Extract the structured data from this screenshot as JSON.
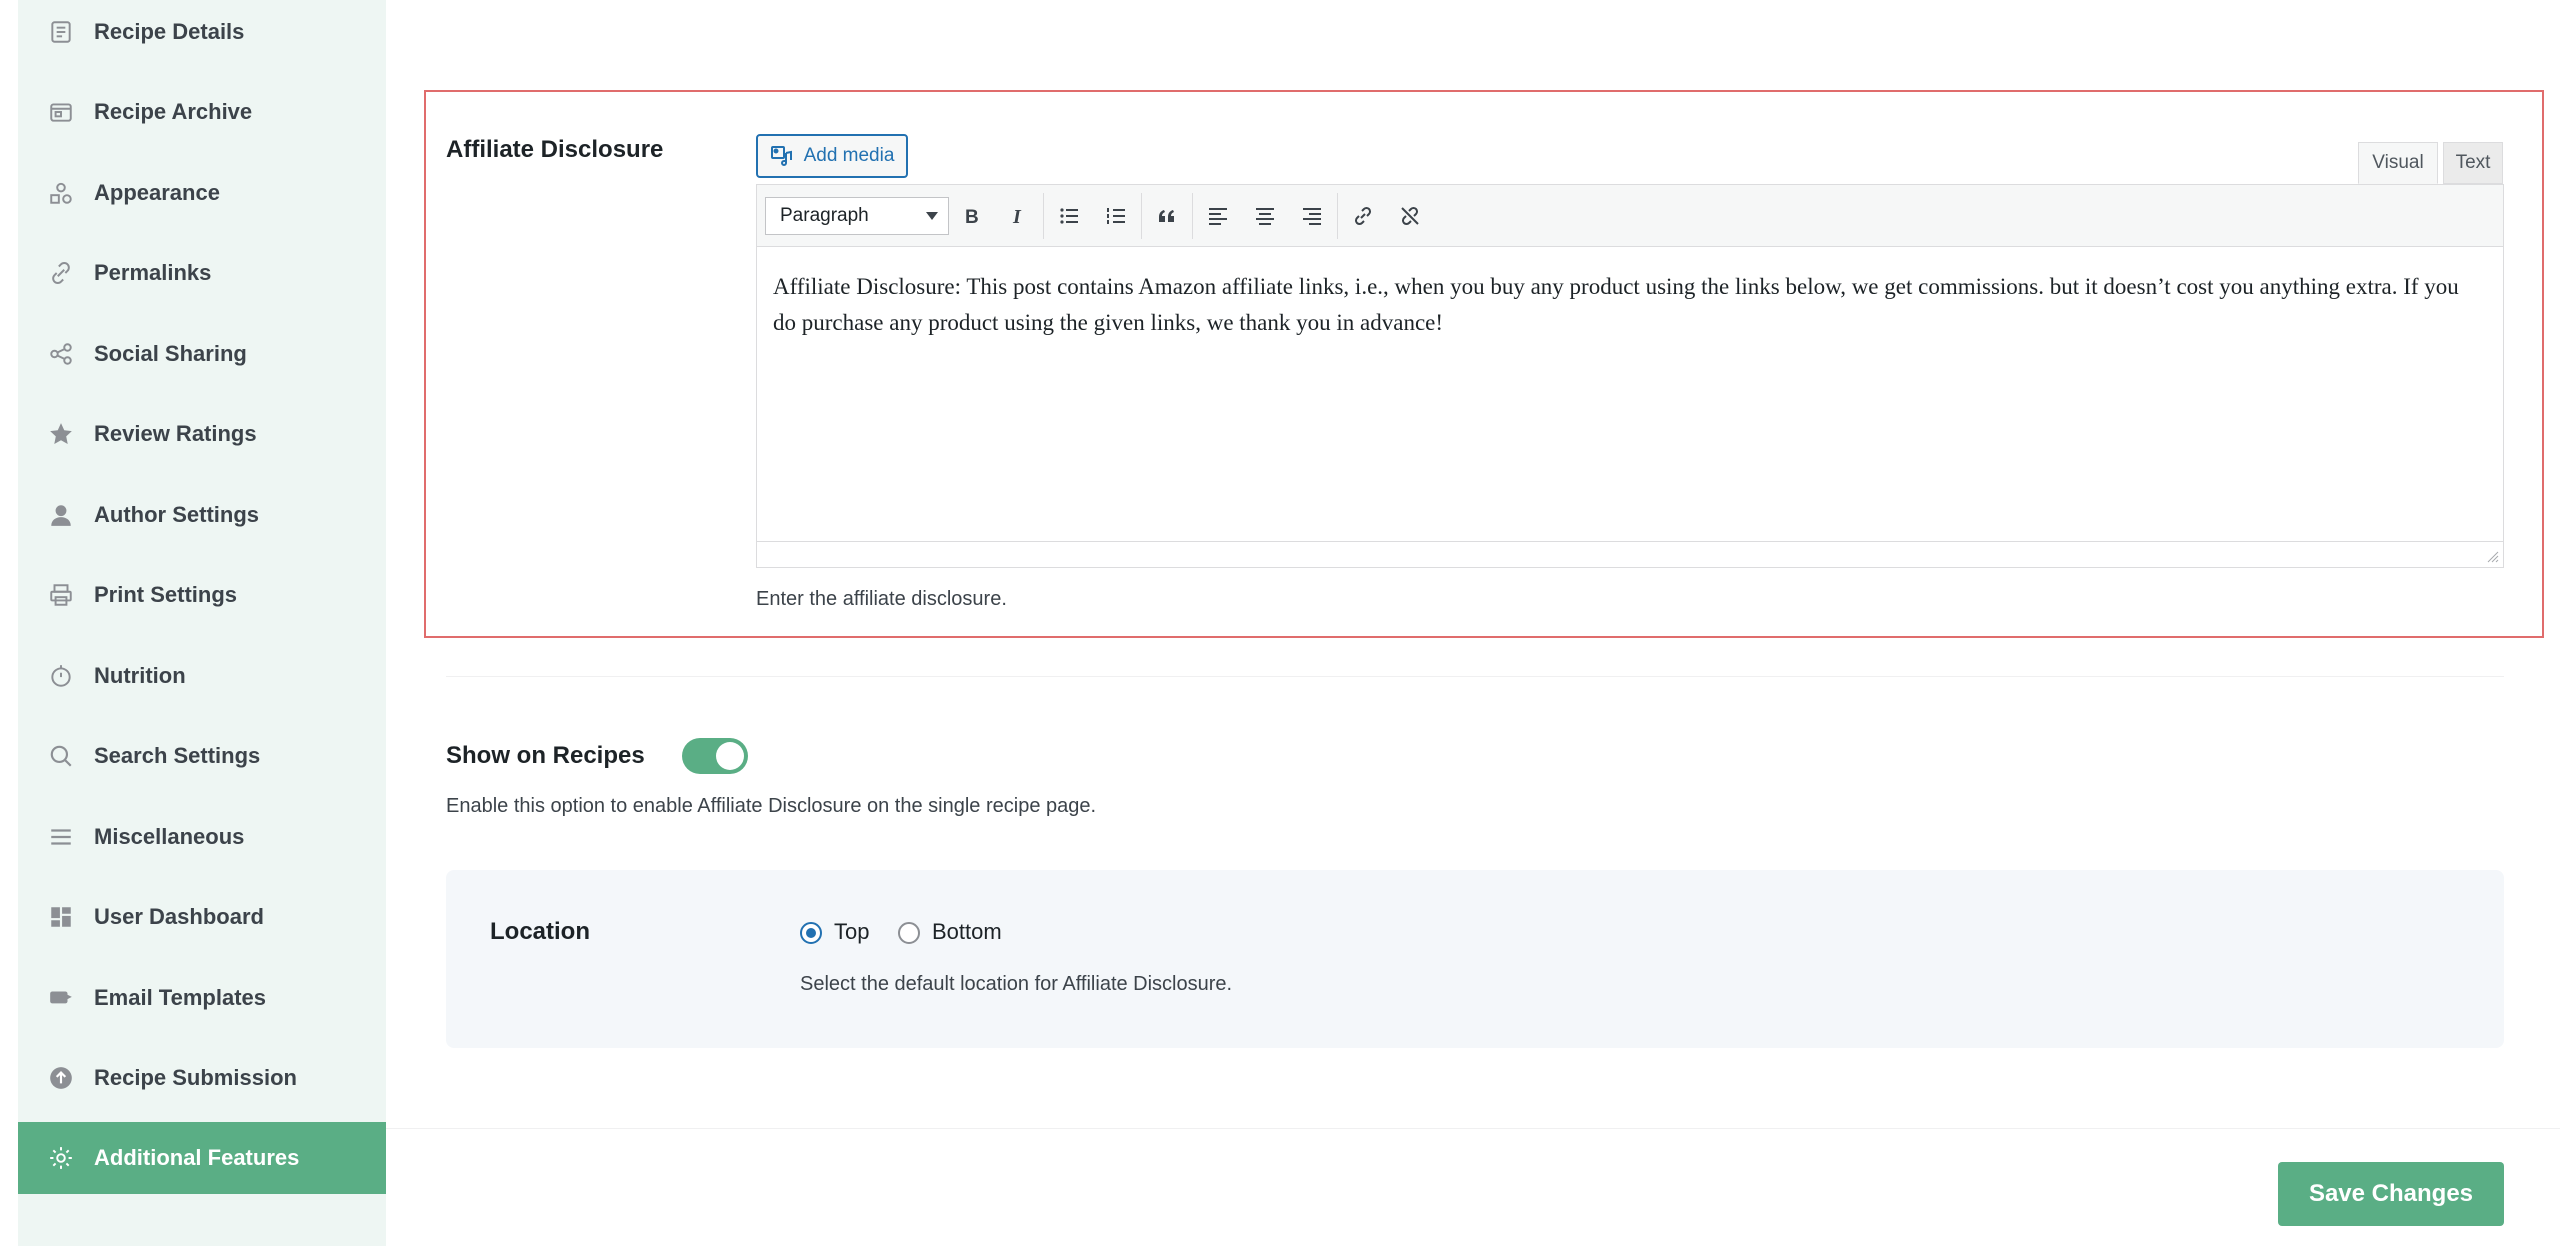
{
  "sidebar": {
    "items": [
      {
        "label": "Recipe Details",
        "icon": "document-icon"
      },
      {
        "label": "Recipe Archive",
        "icon": "archive-icon"
      },
      {
        "label": "Appearance",
        "icon": "shapes-icon"
      },
      {
        "label": "Permalinks",
        "icon": "link-icon"
      },
      {
        "label": "Social Sharing",
        "icon": "share-icon"
      },
      {
        "label": "Review Ratings",
        "icon": "star-icon"
      },
      {
        "label": "Author Settings",
        "icon": "user-icon"
      },
      {
        "label": "Print Settings",
        "icon": "printer-icon"
      },
      {
        "label": "Nutrition",
        "icon": "nutrition-icon"
      },
      {
        "label": "Search Settings",
        "icon": "search-icon"
      },
      {
        "label": "Miscellaneous",
        "icon": "menu-icon"
      },
      {
        "label": "User Dashboard",
        "icon": "dashboard-icon"
      },
      {
        "label": "Email Templates",
        "icon": "email-icon"
      },
      {
        "label": "Recipe Submission",
        "icon": "upload-icon"
      },
      {
        "label": "Additional Features",
        "icon": "gear-icon",
        "active": true
      }
    ]
  },
  "disclosure": {
    "label": "Affiliate Disclosure",
    "add_media": "Add media",
    "tab_visual": "Visual",
    "tab_text": "Text",
    "format_select": "Paragraph",
    "content": "Affiliate Disclosure: This post contains Amazon affiliate links, i.e., when you buy any product using the links below, we get commissions. but it doesn’t cost you anything extra. If you do purchase any product using the given links, we thank you in advance!",
    "help": "Enter the affiliate disclosure."
  },
  "show_on_recipes": {
    "label": "Show on Recipes",
    "enabled": true,
    "help": "Enable this option to enable Affiliate Disclosure on the single recipe page."
  },
  "location": {
    "label": "Location",
    "options": [
      "Top",
      "Bottom"
    ],
    "selected": "Top",
    "help": "Select the default location for Affiliate Disclosure."
  },
  "save_label": "Save Changes",
  "colors": {
    "accent": "#5aae85",
    "highlight_border": "#e06c6c",
    "link": "#2271b1"
  }
}
